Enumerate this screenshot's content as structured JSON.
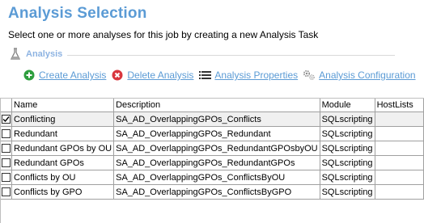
{
  "header": {
    "title": "Analysis Selection",
    "subtitle": "Select one or more analyses for this job by creating a new Analysis Task"
  },
  "section": {
    "label": "Analysis",
    "icon": "flask-icon"
  },
  "toolbar": [
    {
      "label": "Create Analysis",
      "icon": "plus-circle-icon",
      "color": "#2e9e3e"
    },
    {
      "label": "Delete Analysis",
      "icon": "x-circle-icon",
      "color": "#d9363e"
    },
    {
      "label": "Analysis Properties",
      "icon": "list-icon",
      "color": "#333333"
    },
    {
      "label": "Analysis Configuration",
      "icon": "gears-icon",
      "color": "#8a8a8a"
    }
  ],
  "table": {
    "columns": [
      "",
      "Name",
      "Description",
      "Module",
      "HostLists"
    ],
    "rows": [
      {
        "checked": true,
        "name": "Conflicting",
        "description": "SA_AD_OverlappingGPOs_Conflicts",
        "module": "SQLscripting",
        "hostlists": ""
      },
      {
        "checked": false,
        "name": "Redundant",
        "description": "SA_AD_OverlappingGPOs_Redundant",
        "module": "SQLscripting",
        "hostlists": ""
      },
      {
        "checked": false,
        "name": "Redundant GPOs by OU",
        "description": "SA_AD_OverlappingGPOs_RedundantGPOsbyOU",
        "module": "SQLscripting",
        "hostlists": ""
      },
      {
        "checked": false,
        "name": "Redundant GPOs",
        "description": "SA_AD_OverlappingGPOs_RedundantGPOs",
        "module": "SQLscripting",
        "hostlists": ""
      },
      {
        "checked": false,
        "name": "Conflicts by OU",
        "description": "SA_AD_OverlappingGPOs_ConflictsByOU",
        "module": "SQLscripting",
        "hostlists": ""
      },
      {
        "checked": false,
        "name": "Conflicts by GPO",
        "description": "SA_AD_OverlappingGPOs_ConflictsByGPO",
        "module": "SQLscripting",
        "hostlists": ""
      }
    ]
  },
  "colors": {
    "title": "#5b9bd5",
    "link": "#5b9bd5",
    "section": "#8db3e2"
  }
}
